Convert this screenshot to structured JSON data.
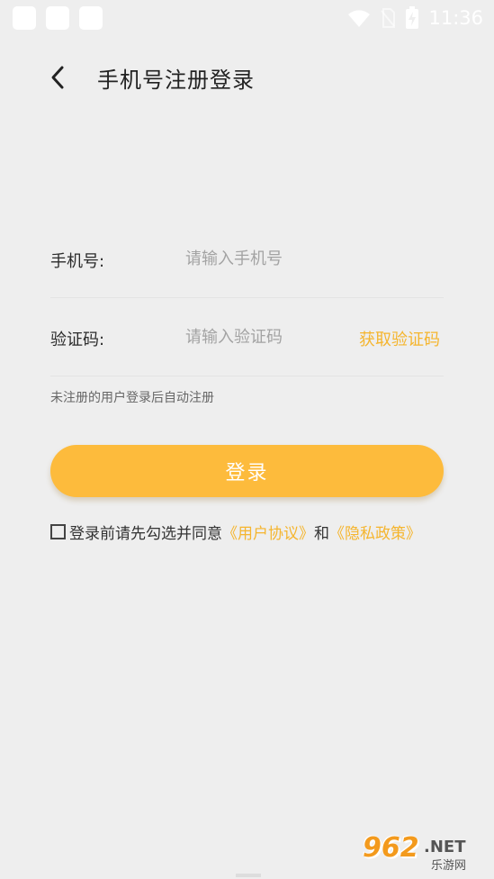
{
  "status_bar": {
    "time": "11:36",
    "icons": [
      "wifi-icon",
      "no-sim-icon",
      "battery-charging-icon"
    ]
  },
  "header": {
    "title": "手机号注册登录",
    "back_icon": "chevron-left-icon"
  },
  "form": {
    "phone_label": "手机号:",
    "phone_placeholder": "请输入手机号",
    "phone_value": "",
    "code_label": "验证码:",
    "code_placeholder": "请输入验证码",
    "code_value": "",
    "get_code_label": "获取验证码"
  },
  "hint": "未注册的用户登录后自动注册",
  "login_button": "登录",
  "agreement": {
    "prefix": "登录前请先勾选并同意",
    "user_agreement": "《用户协议》",
    "and": "和",
    "privacy_policy": "《隐私政策》",
    "checked": false
  },
  "watermark": {
    "brand": "962",
    "suffix": ".NET",
    "cn": "乐游网"
  },
  "colors": {
    "background": "#eeeeee",
    "accent": "#fdbb3c",
    "link": "#f5b52e"
  }
}
